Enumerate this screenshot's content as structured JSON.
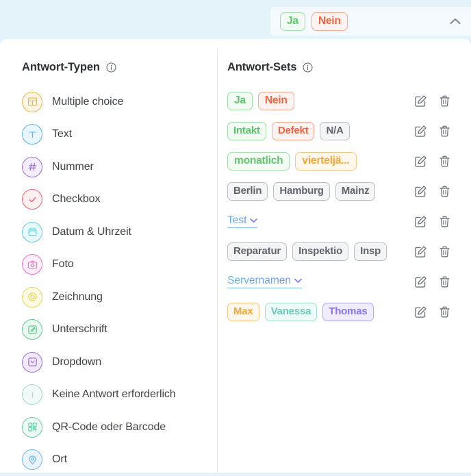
{
  "topbar": {
    "selected_chips": [
      {
        "label": "Ja",
        "color": "#5cc46b",
        "bg": "#f2fbf3",
        "border": "#9fdda8"
      },
      {
        "label": "Nein",
        "color": "#f4653f",
        "bg": "#fef3f0",
        "border": "#f7a98f"
      }
    ],
    "collapse_icon": "chevron-up-icon"
  },
  "left_pane": {
    "title": "Antwort-Typen",
    "info_icon": "info-icon",
    "items": [
      {
        "label": "Multiple choice",
        "icon": "grid-icon",
        "color": "#f0b63e",
        "bg": "#fdf6e6"
      },
      {
        "label": "Text",
        "icon": "text-t-icon",
        "color": "#5ab8ef",
        "bg": "#eaf6fd"
      },
      {
        "label": "Nummer",
        "icon": "hash-icon",
        "color": "#9b6ce0",
        "bg": "#f4eefc"
      },
      {
        "label": "Checkbox",
        "icon": "check-icon",
        "color": "#f2637a",
        "bg": "#fdeef0"
      },
      {
        "label": "Datum & Uhrzeit",
        "icon": "calendar-icon",
        "color": "#5fd2e2",
        "bg": "#e8fafc"
      },
      {
        "label": "Foto",
        "icon": "camera-icon",
        "color": "#ef6fce",
        "bg": "#fdeefa"
      },
      {
        "label": "Zeichnung",
        "icon": "at-sign-icon",
        "color": "#ead551",
        "bg": "#fdfbe5"
      },
      {
        "label": "Unterschrift",
        "icon": "signature-icon",
        "color": "#5fc98d",
        "bg": "#eafaf1"
      },
      {
        "label": "Dropdown",
        "icon": "dropdown-icon",
        "color": "#9b6ce0",
        "bg": "#f1e9fc"
      },
      {
        "label": "Keine Antwort erforderlich",
        "icon": "info-circle-icon",
        "color": "#a8d8cf",
        "bg": "#f0faf8"
      },
      {
        "label": "QR-Code oder Barcode",
        "icon": "qr-code-icon",
        "color": "#6cc9a5",
        "bg": "#ebfaf4"
      },
      {
        "label": "Ort",
        "icon": "map-pin-icon",
        "color": "#6cb6ef",
        "bg": "#eaf4fd"
      }
    ]
  },
  "right_pane": {
    "title": "Antwort-Sets",
    "info_icon": "info-icon",
    "edit_icon": "edit-pencil-icon",
    "delete_icon": "trash-icon",
    "rows": [
      {
        "type": "chips",
        "chips": [
          {
            "label": "Ja",
            "color": "#5cc46b",
            "bg": "#f2fbf3",
            "border": "#9fdda8"
          },
          {
            "label": "Nein",
            "color": "#f4653f",
            "bg": "#fef3f0",
            "border": "#f7a98f"
          }
        ]
      },
      {
        "type": "chips",
        "chips": [
          {
            "label": "Intakt",
            "color": "#5cc46b",
            "bg": "#f2fbf3",
            "border": "#9fdda8"
          },
          {
            "label": "Defekt",
            "color": "#f4653f",
            "bg": "#fef3f0",
            "border": "#f7a98f"
          },
          {
            "label": "N/A",
            "color": "#60656c",
            "bg": "#f4f5f6",
            "border": "#b9bdc2"
          }
        ]
      },
      {
        "type": "chips",
        "chips": [
          {
            "label": "monatlich",
            "color": "#64c46f",
            "bg": "#f3fbf4",
            "border": "#a6dfad"
          },
          {
            "label": "vierteljä...",
            "color": "#f3a93c",
            "bg": "#fef7ec",
            "border": "#f5c887"
          }
        ]
      },
      {
        "type": "chips",
        "chips": [
          {
            "label": "Berlin",
            "color": "#60656c",
            "bg": "#f4f5f6",
            "border": "#b9bdc2"
          },
          {
            "label": "Hamburg",
            "color": "#60656c",
            "bg": "#f4f5f6",
            "border": "#b9bdc2"
          },
          {
            "label": "Mainz",
            "color": "#60656c",
            "bg": "#f4f5f6",
            "border": "#b9bdc2"
          }
        ]
      },
      {
        "type": "link",
        "label": "Test"
      },
      {
        "type": "chips",
        "chips": [
          {
            "label": "Reparatur",
            "color": "#60656c",
            "bg": "#f4f5f6",
            "border": "#b9bdc2"
          },
          {
            "label": "Inspektio",
            "color": "#60656c",
            "bg": "#f4f5f6",
            "border": "#b9bdc2"
          },
          {
            "label": "Insp",
            "color": "#60656c",
            "bg": "#f4f5f6",
            "border": "#b9bdc2"
          }
        ]
      },
      {
        "type": "link",
        "label": "Servernamen"
      },
      {
        "type": "chips",
        "chips": [
          {
            "label": "Max",
            "color": "#f3a93c",
            "bg": "#fef7ec",
            "border": "#f5c887"
          },
          {
            "label": "Vanessa",
            "color": "#6cc9b5",
            "bg": "#eefaf7",
            "border": "#a6ded2"
          },
          {
            "label": "Thomas",
            "color": "#8a72e8",
            "bg": "#f0ecfd",
            "border": "#b3a4f0"
          }
        ]
      }
    ]
  }
}
